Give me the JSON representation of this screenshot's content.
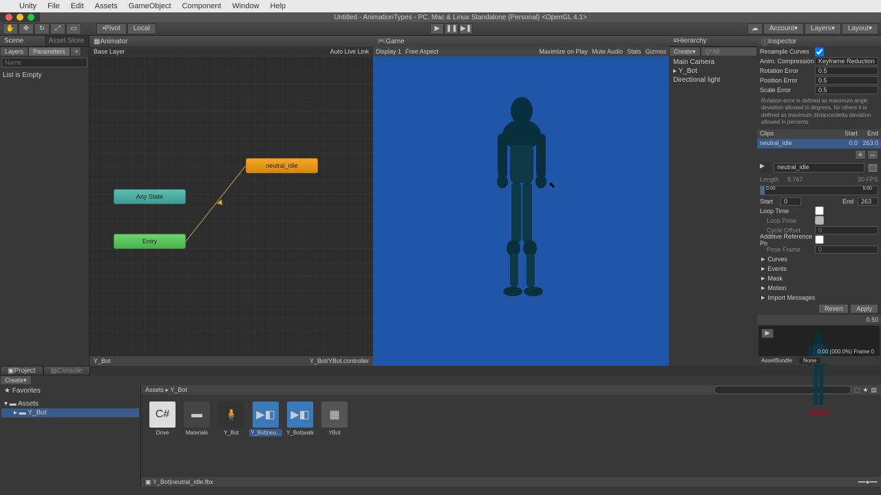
{
  "menu": {
    "apple": "",
    "items": [
      "Unity",
      "File",
      "Edit",
      "Assets",
      "GameObject",
      "Component",
      "Window",
      "Help"
    ]
  },
  "window_title": "Untitled - AnimationTypes - PC, Mac & Linux Standalone (Personal) <OpenGL 4.1>",
  "toolbar": {
    "pivot": "Pivot",
    "local": "Local",
    "account": "Account",
    "layers": "Layers",
    "layout": "Layout"
  },
  "tabs": {
    "scene": "Scene",
    "asset_store": "Asset Store",
    "animator": "Animator",
    "game": "Game",
    "hierarchy": "Hierarchy",
    "inspector": "Inspector",
    "project": "Project",
    "console": "Console"
  },
  "left": {
    "layers": "Layers",
    "parameters": "Parameters",
    "name_placeholder": "Name",
    "empty": "List is Empty"
  },
  "animator": {
    "base_layer": "Base Layer",
    "auto_live_link": "Auto Live Link",
    "nodes": {
      "idle": "neutral_idle",
      "any": "Any State",
      "entry": "Entry"
    },
    "footer_left": "Y_Bot",
    "footer_right": "Y_Bot/YBot.controller"
  },
  "game": {
    "display": "Display 1",
    "aspect": "Free Aspect",
    "maximize": "Maximize on Play",
    "mute": "Mute Audio",
    "stats": "Stats",
    "gizmos": "Gizmos"
  },
  "hierarchy": {
    "create": "Create",
    "qall": "Q*All",
    "items": [
      "Main Camera",
      "Y_Bot",
      "Directional light"
    ]
  },
  "inspector": {
    "resample": "Resample Curves",
    "compression": "Anim. Compression",
    "compression_value": "Keyframe Reduction",
    "rotation_error": "Rotation Error",
    "rotation_error_value": "0.5",
    "position_error": "Position Error",
    "position_error_value": "0.5",
    "scale_error": "Scale Error",
    "scale_error_value": "0.5",
    "error_note": "Rotation error is defined as maximum angle deviation allowed in degrees, for others it is defined as maximum distance/delta deviation allowed in percents",
    "clips_header": "Clips",
    "start_header": "Start",
    "end_header": "End",
    "clip_name": "neutral_idle",
    "clip_start": "0.0",
    "clip_end": "263.0",
    "plus": "+",
    "minus": "–",
    "clip_field": "neutral_idle",
    "length_label": "Length",
    "length_value": "8.767",
    "fps": "30 FPS",
    "time_start": "0:00",
    "time_end": "5:00",
    "start_label": "Start",
    "start_value": "0",
    "end_label": "End",
    "end_value": "263",
    "loop_time": "Loop Time",
    "loop_pose": "Loop Pose",
    "cycle_offset": "Cycle Offset",
    "cycle_offset_value": "0",
    "additive": "Additive Reference Po",
    "pose_frame": "Pose Frame",
    "pose_frame_value": "0",
    "foldouts": [
      "Curves",
      "Events",
      "Mask",
      "Motion",
      "Import Messages"
    ],
    "revert": "Revert",
    "apply": "Apply",
    "preview_time": "0.50",
    "preview_footer": "0:00 (000.0%) Frame 0",
    "asset_bundle": "AssetBundle",
    "asset_bundle_none": "None"
  },
  "project": {
    "create": "Create",
    "favorites": "Favorites",
    "assets": "Assets",
    "ybot": "Y_Bot",
    "breadcrumb_assets": "Assets",
    "breadcrumb_ybot": "Y_Bot",
    "items": [
      {
        "name": "Drive",
        "type": "cs"
      },
      {
        "name": "Materials",
        "type": "folder"
      },
      {
        "name": "Y_Bot",
        "type": "model"
      },
      {
        "name": "Y_Bot|neu...",
        "type": "anim-sel"
      },
      {
        "name": "Y_Bot|walk",
        "type": "anim"
      },
      {
        "name": "YBot",
        "type": "controller"
      }
    ],
    "status": "Y_Bot|neutral_idle.fbx"
  }
}
